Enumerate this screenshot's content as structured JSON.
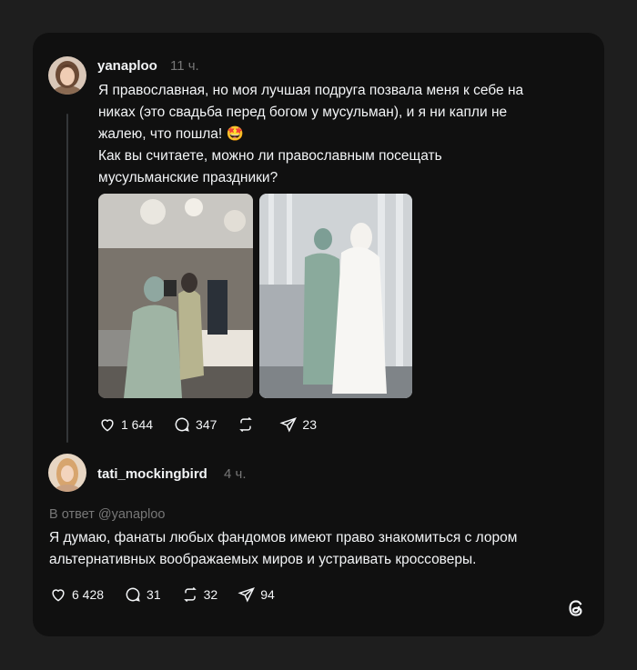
{
  "post": {
    "username": "yanaploo",
    "time": "11 ч.",
    "text": "Я православная, но моя лучшая подруга позвала меня к себе на\nниках (это свадьба перед богом у мусульман), и я ни капли не\nжалею, что пошла! 🤩\nКак вы считаете, можно ли православным посещать\nмусульманские праздники?",
    "likes": "1 644",
    "comments": "347",
    "reposts": "",
    "shares": "23"
  },
  "reply": {
    "username": "tati_mockingbird",
    "time": "4 ч.",
    "reply_to": "В ответ @yanaploo",
    "text": "Я думаю, фанаты любых фандомов имеют право знакомиться с лором\nальтернативных воображаемых миров и устраивать кроссоверы.",
    "likes": "6 428",
    "comments": "31",
    "reposts": "32",
    "shares": "94"
  },
  "icons": {
    "like": "heart-icon",
    "comment": "comment-icon",
    "repost": "repost-icon",
    "share": "share-icon",
    "logo": "threads-logo-icon"
  },
  "colors": {
    "background": "#1e1e1e",
    "card": "#101010",
    "text": "#f3f5f7",
    "muted": "#777777"
  }
}
